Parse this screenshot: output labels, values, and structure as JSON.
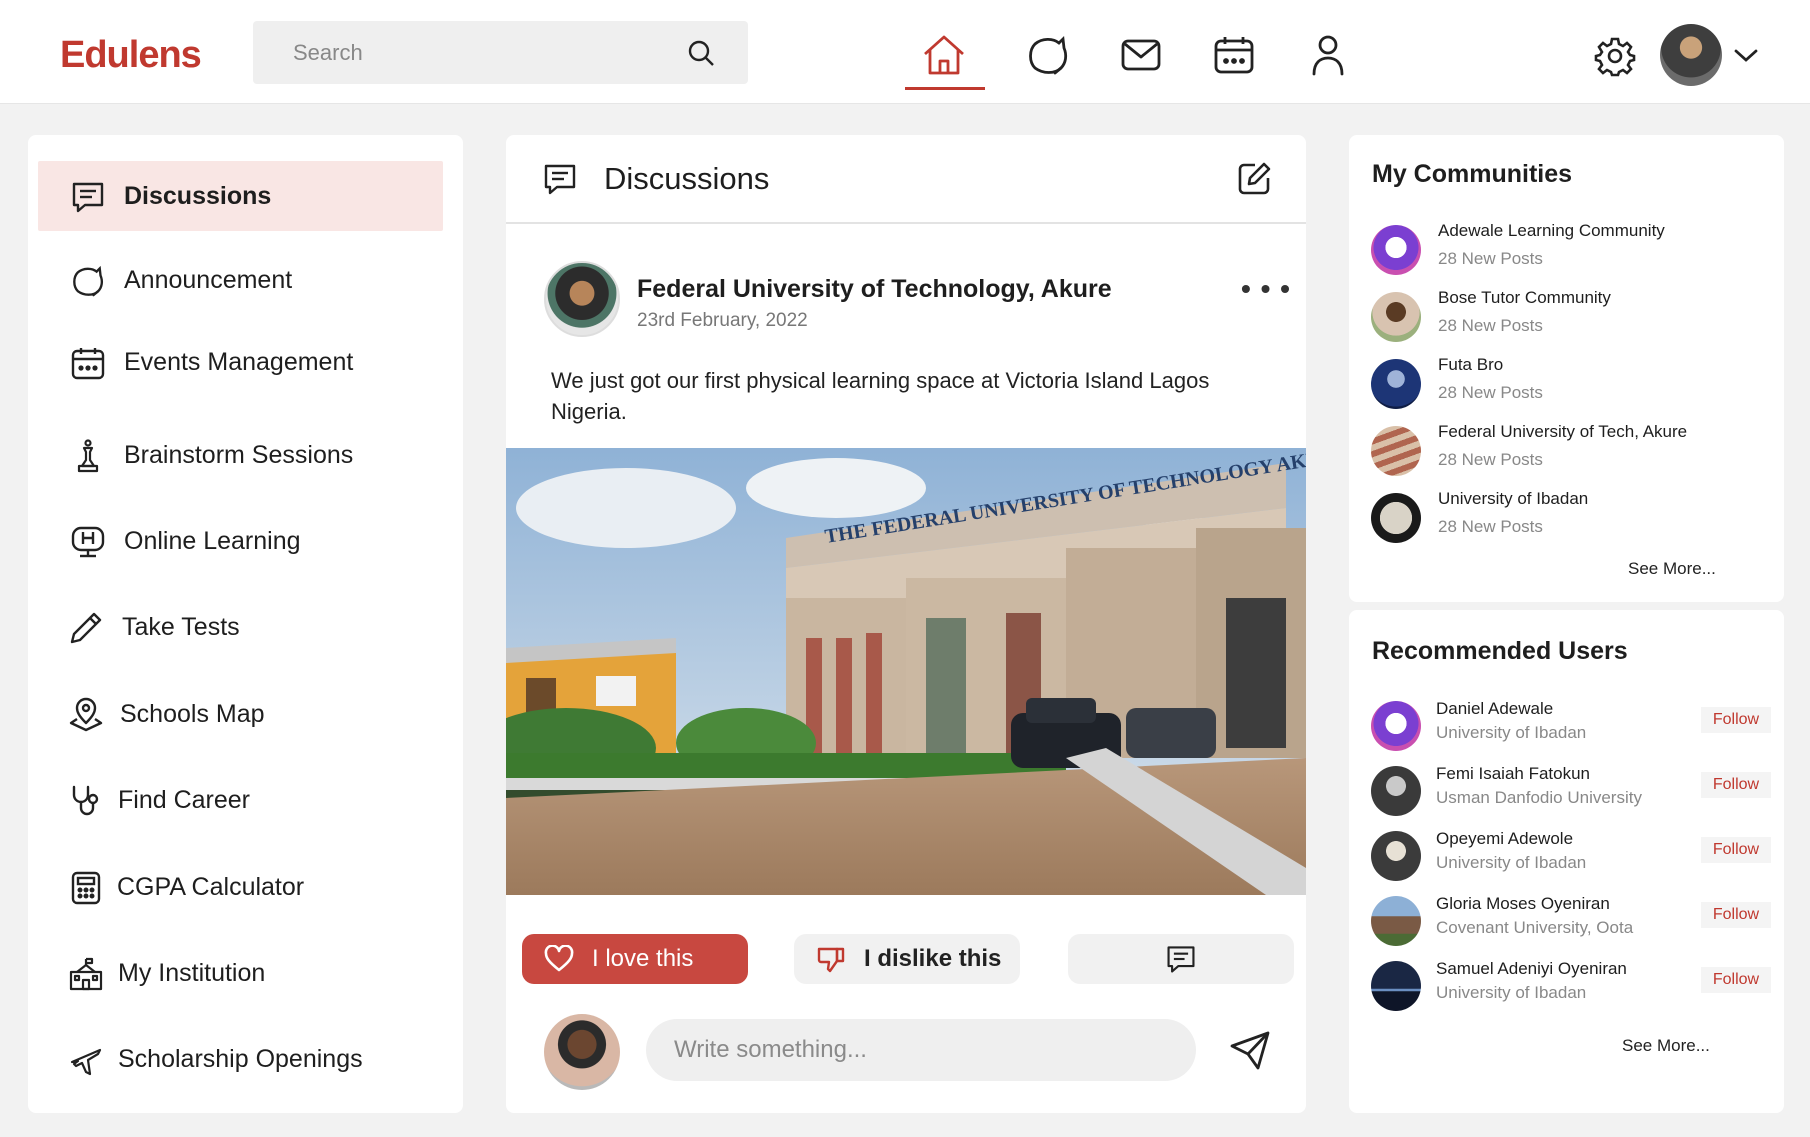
{
  "app": {
    "logo": "Edulens"
  },
  "search": {
    "placeholder": "Search"
  },
  "nav": {
    "icons": [
      "home-icon",
      "announcement-icon",
      "mail-icon",
      "calendar-icon",
      "profile-icon"
    ],
    "active": "home",
    "accent_color": "#c0392f"
  },
  "sidebar": {
    "items": [
      {
        "label": "Discussions",
        "icon": "discussion-icon",
        "active": true
      },
      {
        "label": "Announcement",
        "icon": "announcement-icon"
      },
      {
        "label": "Events Management",
        "icon": "calendar-icon"
      },
      {
        "label": "Brainstorm Sessions",
        "icon": "chess-piece-icon"
      },
      {
        "label": "Online Learning",
        "icon": "online-learning-icon"
      },
      {
        "label": "Take Tests",
        "icon": "pencil-icon"
      },
      {
        "label": "Schools Map",
        "icon": "map-pin-icon"
      },
      {
        "label": "Find Career",
        "icon": "stethoscope-icon"
      },
      {
        "label": "CGPA Calculator",
        "icon": "calculator-icon"
      },
      {
        "label": "My Institution",
        "icon": "school-icon"
      },
      {
        "label": "Scholarship Openings",
        "icon": "plane-icon"
      }
    ]
  },
  "main": {
    "title": "Discussions",
    "post": {
      "author": "Federal University of Technology, Akure",
      "date": "23rd February, 2022",
      "text": "We just got our first physical learning space at Victoria Island Lagos Nigeria.",
      "image_text": "THE FEDERAL UNIVERSITY OF TECHNOLOGY AKURE"
    },
    "actions": {
      "love": "I love this",
      "dislike": "I dislike this"
    },
    "comment": {
      "placeholder": "Write something..."
    }
  },
  "communities": {
    "title": "My Communities",
    "items": [
      {
        "name": "Adewale Learning Community",
        "posts": "28 New Posts"
      },
      {
        "name": "Bose Tutor Community",
        "posts": "28 New Posts"
      },
      {
        "name": "Futa Bro",
        "posts": "28 New Posts"
      },
      {
        "name": "Federal University of Tech, Akure",
        "posts": "28 New Posts"
      },
      {
        "name": "University of Ibadan",
        "posts": "28 New Posts"
      }
    ],
    "see_more": "See More..."
  },
  "recommended": {
    "title": "Recommended Users",
    "follow_label": "Follow",
    "users": [
      {
        "name": "Daniel Adewale",
        "school": "University of Ibadan"
      },
      {
        "name": "Femi Isaiah Fatokun",
        "school": "Usman Danfodio University"
      },
      {
        "name": "Opeyemi Adewole",
        "school": "University of Ibadan"
      },
      {
        "name": "Gloria Moses Oyeniran",
        "school": "Covenant University, Oota"
      },
      {
        "name": "Samuel Adeniyi Oyeniran",
        "school": "University of Ibadan"
      }
    ],
    "see_more": "See More..."
  }
}
